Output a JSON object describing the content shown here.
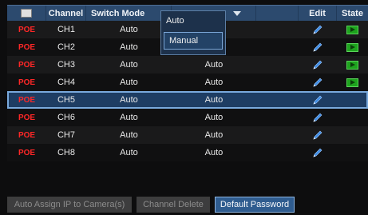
{
  "header": {
    "channel": "Channel",
    "switch_mode": "Switch Mode",
    "edit": "Edit",
    "state": "State"
  },
  "dropdown": {
    "options": [
      "Auto",
      "Manual"
    ],
    "selected": "Manual"
  },
  "rows": [
    {
      "source": "POE",
      "channel": "CH1",
      "mode": "Auto",
      "value": "",
      "state": "playing"
    },
    {
      "source": "POE",
      "channel": "CH2",
      "mode": "Auto",
      "value": "",
      "state": "playing"
    },
    {
      "source": "POE",
      "channel": "CH3",
      "mode": "Auto",
      "value": "Auto",
      "state": "playing"
    },
    {
      "source": "POE",
      "channel": "CH4",
      "mode": "Auto",
      "value": "Auto",
      "state": "playing"
    },
    {
      "source": "POE",
      "channel": "CH5",
      "mode": "Auto",
      "value": "Auto",
      "state": ""
    },
    {
      "source": "POE",
      "channel": "CH6",
      "mode": "Auto",
      "value": "Auto",
      "state": ""
    },
    {
      "source": "POE",
      "channel": "CH7",
      "mode": "Auto",
      "value": "Auto",
      "state": ""
    },
    {
      "source": "POE",
      "channel": "CH8",
      "mode": "Auto",
      "value": "Auto",
      "state": ""
    }
  ],
  "buttons": {
    "auto_assign": "Auto Assign IP to Camera(s)",
    "channel_delete": "Channel Delete",
    "default_password": "Default Password"
  },
  "colors": {
    "header_bg": "#2c4a6e",
    "selected_row": "#1e3d63",
    "poe_text": "#ff2727",
    "state_green": "#1ea31e"
  }
}
